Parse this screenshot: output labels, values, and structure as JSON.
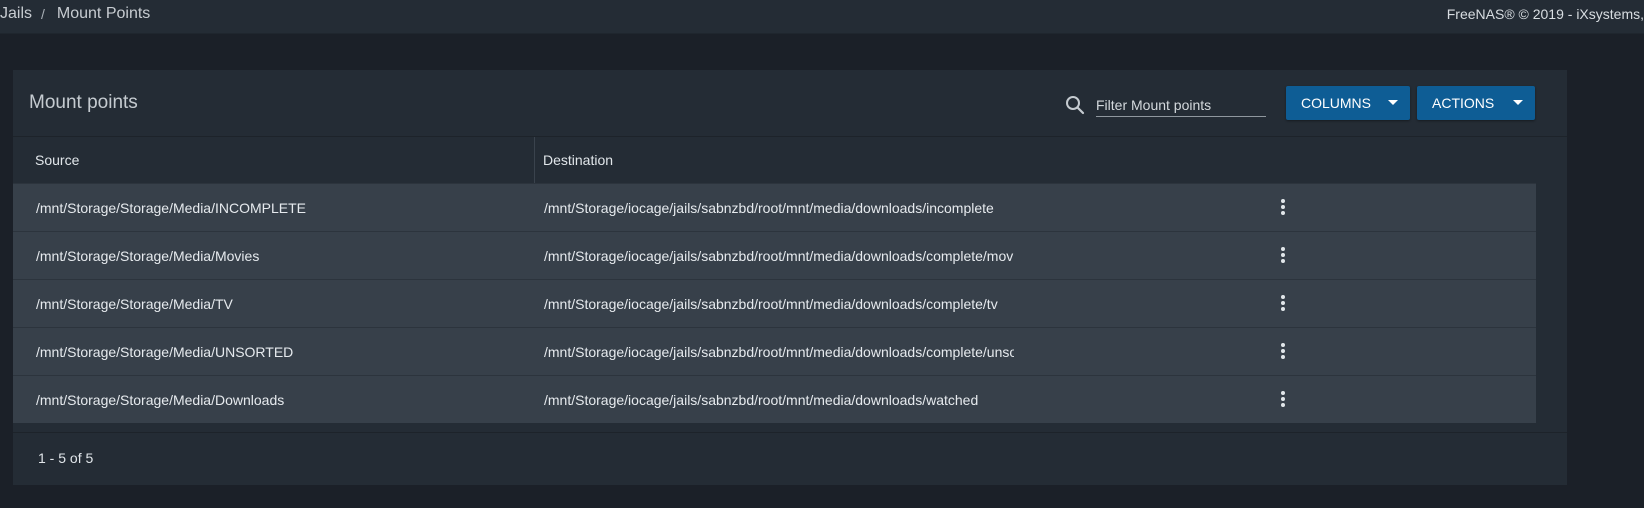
{
  "breadcrumb": {
    "items": [
      "Jails",
      "Mount Points"
    ],
    "separator": "/"
  },
  "copyright": "FreeNAS® © 2019 - iXsystems,",
  "card": {
    "title": "Mount points",
    "search": {
      "placeholder": "Filter Mount points",
      "value": "",
      "icon": "search-icon"
    },
    "buttons": {
      "columns": "COLUMNS",
      "actions": "ACTIONS"
    },
    "table": {
      "columns": [
        "Source",
        "Destination"
      ],
      "rows": [
        {
          "source": "/mnt/Storage/Storage/Media/INCOMPLETE",
          "destination": "/mnt/Storage/iocage/jails/sabnzbd/root/mnt/media/downloads/incomplete"
        },
        {
          "source": "/mnt/Storage/Storage/Media/Movies",
          "destination": "/mnt/Storage/iocage/jails/sabnzbd/root/mnt/media/downloads/complete/movies"
        },
        {
          "source": "/mnt/Storage/Storage/Media/TV",
          "destination": "/mnt/Storage/iocage/jails/sabnzbd/root/mnt/media/downloads/complete/tv"
        },
        {
          "source": "/mnt/Storage/Storage/Media/UNSORTED",
          "destination": "/mnt/Storage/iocage/jails/sabnzbd/root/mnt/media/downloads/complete/unsorted"
        },
        {
          "source": "/mnt/Storage/Storage/Media/Downloads",
          "destination": "/mnt/Storage/iocage/jails/sabnzbd/root/mnt/media/downloads/watched"
        }
      ]
    },
    "pagination": {
      "range_label": "1 - 5 of 5"
    }
  },
  "colors": {
    "accent": "#0e5d95",
    "background": "#1b2028",
    "card": "#242c35",
    "row": "#37404a"
  }
}
